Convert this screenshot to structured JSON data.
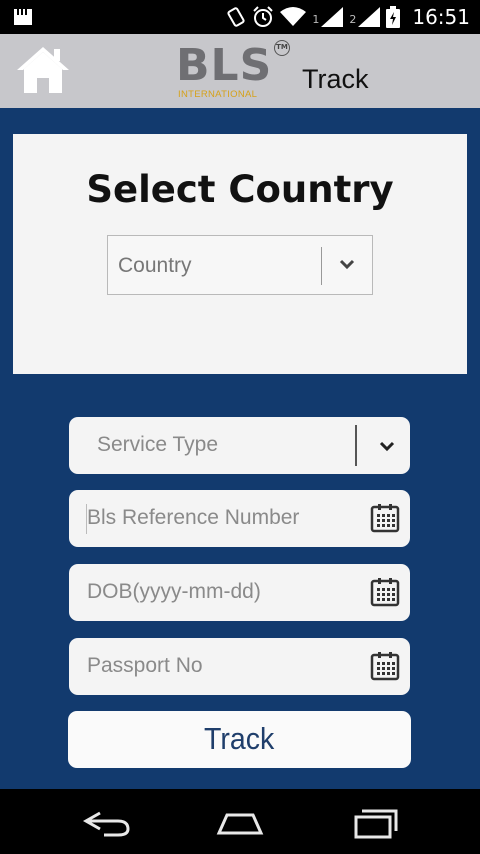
{
  "status_bar": {
    "time": "16:51",
    "sim1": "1",
    "sim2": "2"
  },
  "header": {
    "logo_text": "BLS",
    "logo_tm": "TM",
    "logo_subtitle": "INTERNATIONAL",
    "title": "Track",
    "home_icon": "home-icon"
  },
  "country_card": {
    "title": "Select Country",
    "select_value": "Country"
  },
  "form": {
    "service_type": "Service Type",
    "reference_placeholder": "Bls Reference Number",
    "dob_placeholder": "DOB(yyyy-mm-dd)",
    "passport_placeholder": "Passport No",
    "submit_label": "Track"
  },
  "colors": {
    "background": "#123a6e",
    "header_bg": "#c7c7cb",
    "button_text": "#1f3e6b",
    "logo_gold": "#d6a21b"
  },
  "nav_icons": [
    "back-icon",
    "home-icon",
    "recent-apps-icon"
  ]
}
